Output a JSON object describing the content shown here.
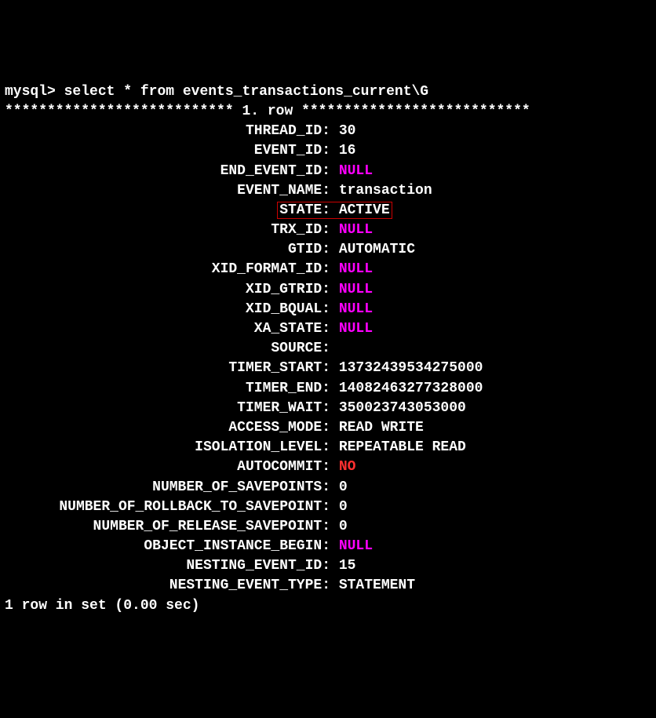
{
  "prompt": "mysql> ",
  "query": "select * from events_transactions_current\\G",
  "separator_left": "*************************** ",
  "row_label": "1. row",
  "separator_right": " ***************************",
  "fields": [
    {
      "label": "THREAD_ID",
      "value": "30",
      "type": "normal"
    },
    {
      "label": "EVENT_ID",
      "value": "16",
      "type": "normal"
    },
    {
      "label": "END_EVENT_ID",
      "value": "NULL",
      "type": "null"
    },
    {
      "label": "EVENT_NAME",
      "value": "transaction",
      "type": "normal"
    },
    {
      "label": "STATE",
      "value": "ACTIVE",
      "type": "boxed"
    },
    {
      "label": "TRX_ID",
      "value": "NULL",
      "type": "null"
    },
    {
      "label": "GTID",
      "value": "AUTOMATIC",
      "type": "normal"
    },
    {
      "label": "XID_FORMAT_ID",
      "value": "NULL",
      "type": "null"
    },
    {
      "label": "XID_GTRID",
      "value": "NULL",
      "type": "null"
    },
    {
      "label": "XID_BQUAL",
      "value": "NULL",
      "type": "null"
    },
    {
      "label": "XA_STATE",
      "value": "NULL",
      "type": "null"
    },
    {
      "label": "SOURCE",
      "value": "",
      "type": "normal"
    },
    {
      "label": "TIMER_START",
      "value": "13732439534275000",
      "type": "normal"
    },
    {
      "label": "TIMER_END",
      "value": "14082463277328000",
      "type": "normal"
    },
    {
      "label": "TIMER_WAIT",
      "value": "350023743053000",
      "type": "normal"
    },
    {
      "label": "ACCESS_MODE",
      "value": "READ WRITE",
      "type": "normal"
    },
    {
      "label": "ISOLATION_LEVEL",
      "value": "REPEATABLE READ",
      "type": "normal"
    },
    {
      "label": "AUTOCOMMIT",
      "value": "NO",
      "type": "red"
    },
    {
      "label": "NUMBER_OF_SAVEPOINTS",
      "value": "0",
      "type": "normal"
    },
    {
      "label": "NUMBER_OF_ROLLBACK_TO_SAVEPOINT",
      "value": "0",
      "type": "normal"
    },
    {
      "label": "NUMBER_OF_RELEASE_SAVEPOINT",
      "value": "0",
      "type": "normal"
    },
    {
      "label": "OBJECT_INSTANCE_BEGIN",
      "value": "NULL",
      "type": "null"
    },
    {
      "label": "NESTING_EVENT_ID",
      "value": "15",
      "type": "normal"
    },
    {
      "label": "NESTING_EVENT_TYPE",
      "value": "STATEMENT",
      "type": "normal"
    }
  ],
  "footer": "1 row in set (0.00 sec)"
}
